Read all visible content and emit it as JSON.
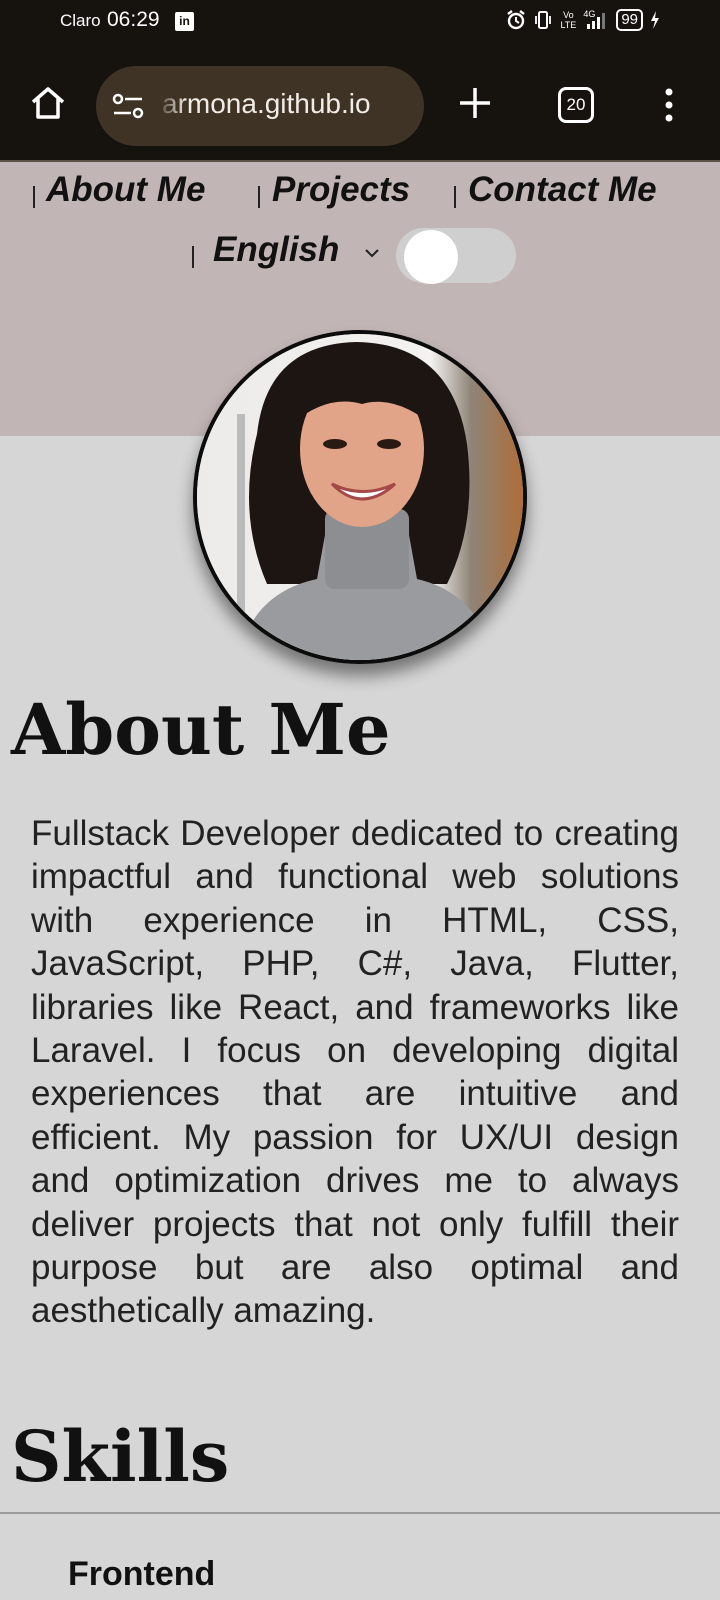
{
  "status_bar": {
    "carrier": "Claro",
    "time": "06:29",
    "notification_app": "in",
    "network_tech": [
      "Vo",
      "LTE"
    ],
    "network_gen": "4G",
    "battery": "99",
    "icons": [
      "alarm-icon",
      "vibrate-icon",
      "signal-icon",
      "battery-icon",
      "charging-icon",
      "linkedin-icon"
    ]
  },
  "browser": {
    "url": "armona.github.io",
    "tab_count": "20",
    "icons": [
      "home-icon",
      "site-settings-icon",
      "new-tab-icon",
      "tab-switcher-icon",
      "more-menu-icon"
    ]
  },
  "nav": {
    "links": [
      {
        "label": "About Me"
      },
      {
        "label": "Projects"
      },
      {
        "label": "Contact Me"
      }
    ],
    "language": "English",
    "theme_toggle_on": false
  },
  "profile": {
    "photo_alt": "profile photo"
  },
  "about": {
    "title": "About Me",
    "text": "Fullstack Developer dedicated to creating impactful and functional web solutions with experience in HTML, CSS, JavaScript, PHP, C#, Java, Flutter, libraries like React, and frameworks like Laravel. I focus on developing digital experiences that are intuitive and efficient. My passion for UX/UI design and optimization drives me to always deliver projects that not only fulfill their purpose but are also optimal and aesthetically amazing."
  },
  "skills": {
    "title": "Skills",
    "categories": [
      "Frontend"
    ]
  },
  "colors": {
    "chrome_bg": "#16130f",
    "urlbar_bg": "#3f3326",
    "nav_bg": "#c2b5b5",
    "page_bg": "#d6d6d6"
  }
}
